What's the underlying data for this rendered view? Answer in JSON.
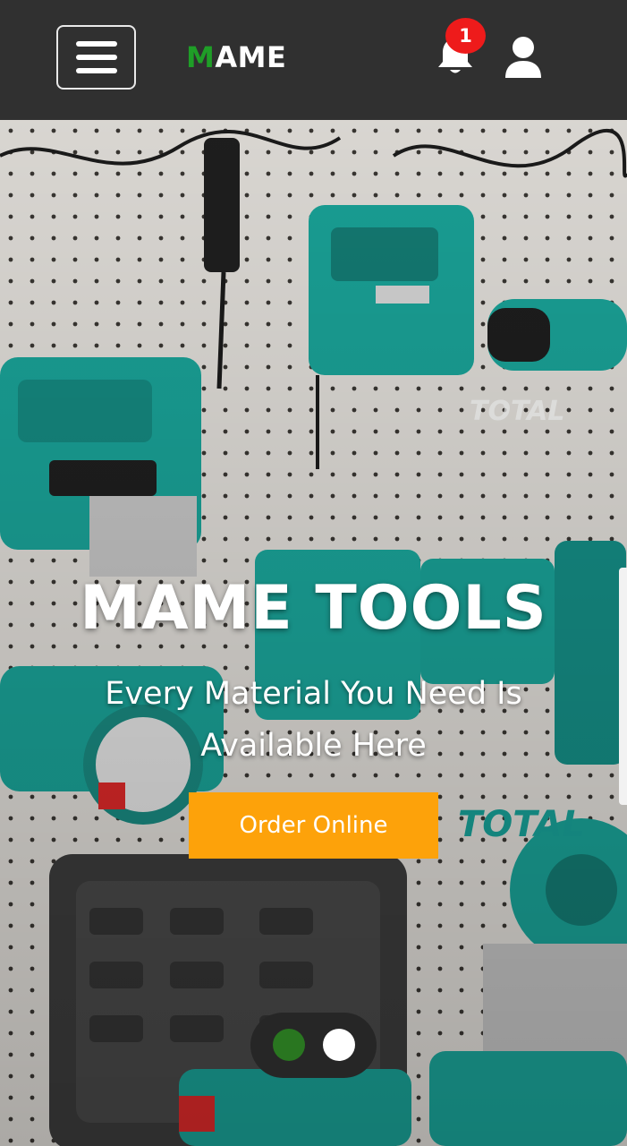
{
  "header": {
    "menu_icon": "hamburger-menu-icon",
    "logo_first": "M",
    "logo_rest": "AME",
    "notification_icon": "bell-icon",
    "notification_count": "1",
    "profile_icon": "user-icon",
    "logo_accent_color": "#1f9e27",
    "badge_color": "#ee1b1b"
  },
  "hero": {
    "title": "MAME TOOLS",
    "subtitle": "Every Material You Need Is Available Here",
    "cta_label": "Order Online",
    "cta_color": "#fda20a",
    "slides": [
      {
        "active": true,
        "color": "#297620"
      },
      {
        "active": false,
        "color": "#ffffff"
      }
    ]
  }
}
